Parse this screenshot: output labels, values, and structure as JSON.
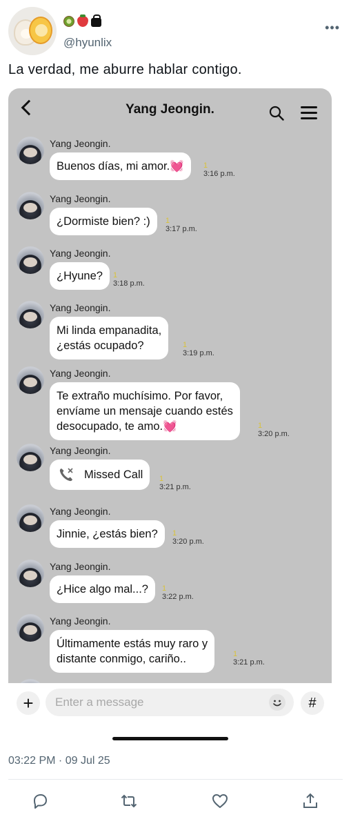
{
  "tweet": {
    "handle": "@hyunlix",
    "badges": [
      "kiwi-emoji",
      "strawberry-emoji",
      "shopping-bag-emoji"
    ],
    "text": "La verdad, me aburre hablar contigo.",
    "timestamp": "03:22 PM · 09 Jul 25"
  },
  "chat": {
    "title": "Yang Jeongin.",
    "background": "#c3c3c3",
    "read_marker": "1",
    "messages": [
      {
        "sender": "Yang Jeongin.",
        "text": "Buenos días, mi amor.",
        "heart": "💓",
        "time": "3:16 p.m."
      },
      {
        "sender": "Yang Jeongin.",
        "text": "¿Dormiste bien? :)",
        "time": "3:17 p.m."
      },
      {
        "sender": "Yang Jeongin.",
        "text": "¿Hyune?",
        "time": "3:18 p.m."
      },
      {
        "sender": "Yang Jeongin.",
        "line1": "Mi linda empanadita,",
        "line2": "¿estás ocupado?",
        "time": "3:19 p.m."
      },
      {
        "sender": "Yang Jeongin.",
        "line1": "Te extraño muchísimo. Por favor,",
        "line2": "envíame un mensaje cuando estés",
        "line3": "desocupado, te amo.",
        "heart": "💓",
        "time": "3:20 p.m."
      },
      {
        "sender": "Yang Jeongin.",
        "text": "Missed Call",
        "time": "3:21 p.m."
      },
      {
        "sender": "Yang Jeongin.",
        "text": "Jinnie, ¿estás bien?",
        "time": "3:20 p.m."
      },
      {
        "sender": "Yang Jeongin.",
        "text": "¿Hice algo mal...?",
        "time": "3:22 p.m."
      },
      {
        "sender": "Yang Jeongin.",
        "line1": "Últimamente estás muy raro y",
        "line2": "distante conmigo, cariño..",
        "time": "3:21 p.m."
      }
    ],
    "input": {
      "placeholder": "Enter a message"
    }
  }
}
